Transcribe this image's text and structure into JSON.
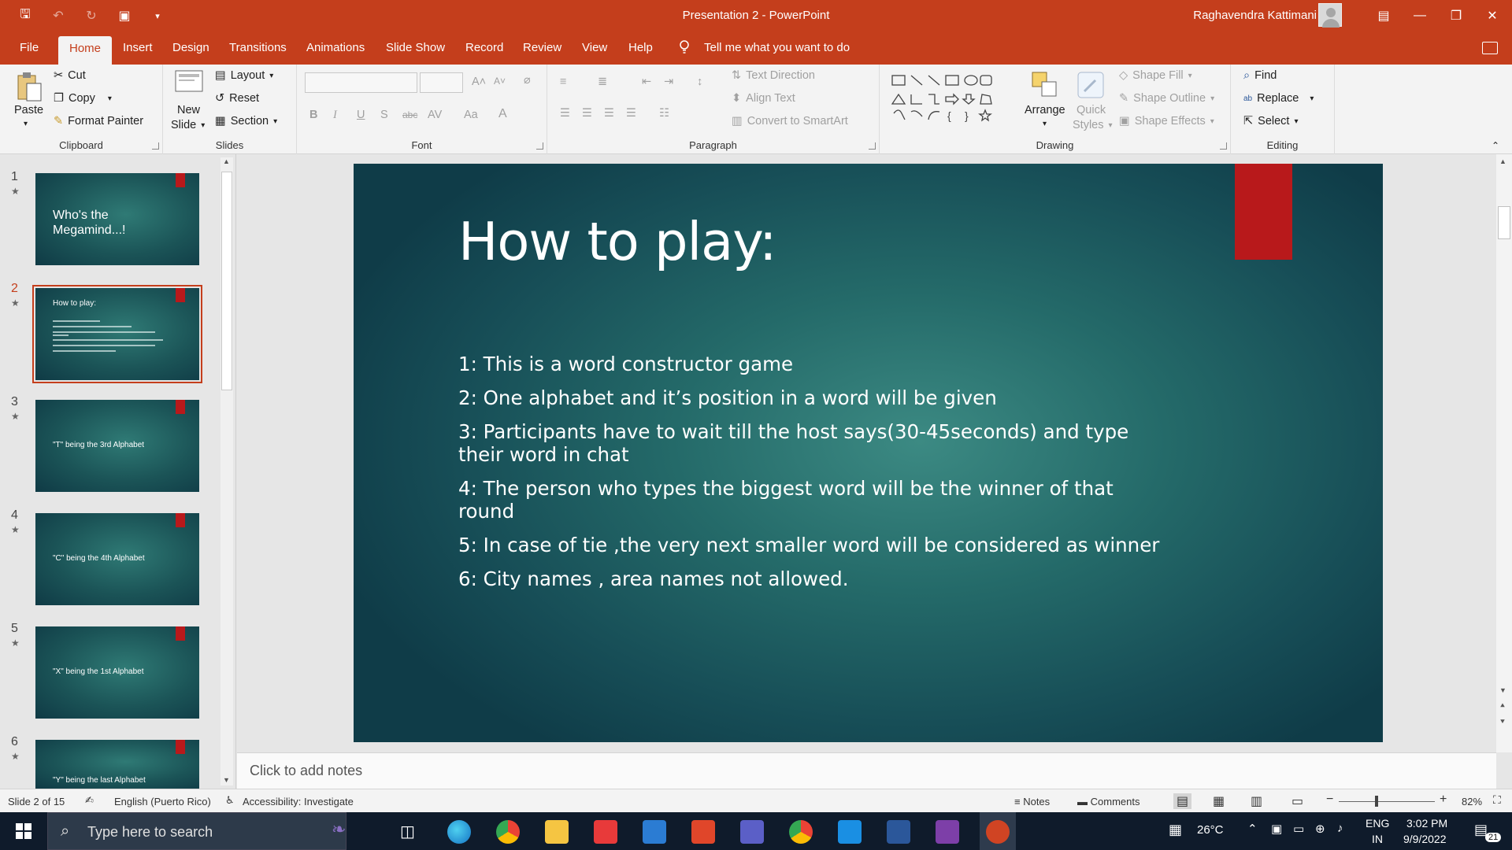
{
  "window": {
    "title": "Presentation 2  -  PowerPoint",
    "user": "Raghavendra Kattimani"
  },
  "menu": {
    "items": [
      "File",
      "Home",
      "Insert",
      "Design",
      "Transitions",
      "Animations",
      "Slide Show",
      "Record",
      "Review",
      "View",
      "Help"
    ],
    "active": "Home",
    "tell_me": "Tell me what you want to do"
  },
  "ribbon": {
    "clipboard": {
      "label": "Clipboard",
      "paste": "Paste",
      "cut": "Cut",
      "copy": "Copy",
      "format_painter": "Format Painter"
    },
    "slides": {
      "label": "Slides",
      "new_slide_1": "New",
      "new_slide_2": "Slide",
      "layout": "Layout",
      "reset": "Reset",
      "section": "Section"
    },
    "font": {
      "label": "Font"
    },
    "paragraph": {
      "label": "Paragraph",
      "text_direction": "Text Direction",
      "align_text": "Align Text",
      "convert_smartart": "Convert to SmartArt"
    },
    "drawing": {
      "label": "Drawing",
      "arrange": "Arrange",
      "quick_styles_1": "Quick",
      "quick_styles_2": "Styles",
      "shape_fill": "Shape Fill",
      "shape_outline": "Shape Outline",
      "shape_effects": "Shape Effects"
    },
    "editing": {
      "label": "Editing",
      "find": "Find",
      "replace": "Replace",
      "select": "Select"
    }
  },
  "thumbnails": [
    {
      "num": "1",
      "text": "Who's the Megamind...!",
      "selected": false
    },
    {
      "num": "2",
      "text": "How to play:",
      "selected": true
    },
    {
      "num": "3",
      "text": "\"T\" being the 3rd Alphabet",
      "selected": false
    },
    {
      "num": "4",
      "text": "\"C\" being the 4th Alphabet",
      "selected": false
    },
    {
      "num": "5",
      "text": "\"X\" being the 1st Alphabet",
      "selected": false
    },
    {
      "num": "6",
      "text": "\"Y\" being the last Alphabet",
      "selected": false
    }
  ],
  "slide": {
    "title": "How to play:",
    "items": [
      "1: This is a word constructor game",
      "2: One alphabet and it’s position in a word will be given",
      "3: Participants have to wait till the host says(30-45seconds) and type their word in chat",
      "4: The person who types the biggest word will be the winner of that round",
      "5: In case of tie ,the very next smaller word will be considered as winner",
      "6: City names , area names not allowed."
    ]
  },
  "notes_placeholder": "Click to add notes",
  "status": {
    "slide_count": "Slide 2 of 15",
    "language": "English (Puerto Rico)",
    "accessibility": "Accessibility: Investigate",
    "notes": "Notes",
    "comments": "Comments",
    "zoom": "82%"
  },
  "taskbar": {
    "search_placeholder": "Type here to search",
    "temperature": "26°C",
    "lang_1": "ENG",
    "lang_2": "IN",
    "time": "3:02 PM",
    "date": "9/9/2022",
    "notifications": "21"
  },
  "colors": {
    "accent": "#c43e1c",
    "slide_red": "#b8191b",
    "slide_teal": "#246a69"
  }
}
